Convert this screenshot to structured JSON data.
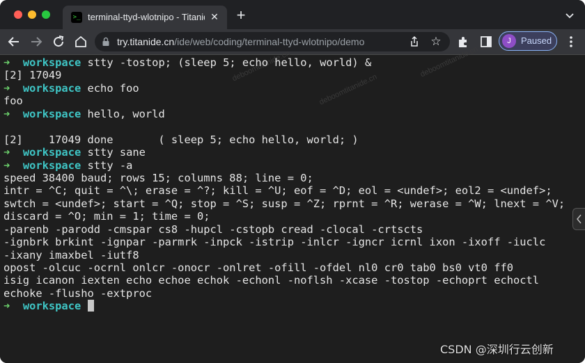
{
  "browser": {
    "tab_title": "terminal-ttyd-wlotnipo - Titanide",
    "url_host": "try.titanide.cn",
    "url_path": "/ide/web/coding/terminal-ttyd-wlotnipo/demo",
    "profile_initial": "J",
    "profile_label": "Paused",
    "favicon_text": ">_"
  },
  "terminal": {
    "prompt_arrow": "➜",
    "prompt_dir": "workspace",
    "lines": [
      {
        "kind": "prompt",
        "cmd": "stty -tostop; (sleep 5; echo hello, world) &"
      },
      {
        "kind": "out",
        "text": "[2] 17049"
      },
      {
        "kind": "prompt",
        "cmd": "echo foo"
      },
      {
        "kind": "out",
        "text": "foo"
      },
      {
        "kind": "prompt",
        "cmd": "hello, world"
      },
      {
        "kind": "out",
        "text": ""
      },
      {
        "kind": "out",
        "text": "[2]    17049 done       ( sleep 5; echo hello, world; )"
      },
      {
        "kind": "prompt",
        "cmd": "stty sane"
      },
      {
        "kind": "prompt",
        "cmd": "stty -a"
      },
      {
        "kind": "out",
        "text": "speed 38400 baud; rows 15; columns 88; line = 0;"
      },
      {
        "kind": "out",
        "text": "intr = ^C; quit = ^\\; erase = ^?; kill = ^U; eof = ^D; eol = <undef>; eol2 = <undef>;"
      },
      {
        "kind": "out",
        "text": "swtch = <undef>; start = ^Q; stop = ^S; susp = ^Z; rprnt = ^R; werase = ^W; lnext = ^V;"
      },
      {
        "kind": "out",
        "text": "discard = ^O; min = 1; time = 0;"
      },
      {
        "kind": "out",
        "text": "-parenb -parodd -cmspar cs8 -hupcl -cstopb cread -clocal -crtscts"
      },
      {
        "kind": "out",
        "text": "-ignbrk brkint -ignpar -parmrk -inpck -istrip -inlcr -igncr icrnl ixon -ixoff -iuclc"
      },
      {
        "kind": "out",
        "text": "-ixany imaxbel -iutf8"
      },
      {
        "kind": "out",
        "text": "opost -olcuc -ocrnl onlcr -onocr -onlret -ofill -ofdel nl0 cr0 tab0 bs0 vt0 ff0"
      },
      {
        "kind": "out",
        "text": "isig icanon iexten echo echoe echok -echonl -noflsh -xcase -tostop -echoprt echoctl"
      },
      {
        "kind": "out",
        "text": "echoke -flusho -extproc"
      },
      {
        "kind": "prompt",
        "cmd": "",
        "cursor": true
      }
    ]
  },
  "overlay": {
    "watermark_text": "deboomtitanide.cn",
    "csdn_label": "CSDN @深圳行云创新"
  },
  "colors": {
    "prompt_arrow": "#6dd46d",
    "prompt_dir": "#3fc6c6",
    "terminal_bg": "#1e1e1e"
  }
}
